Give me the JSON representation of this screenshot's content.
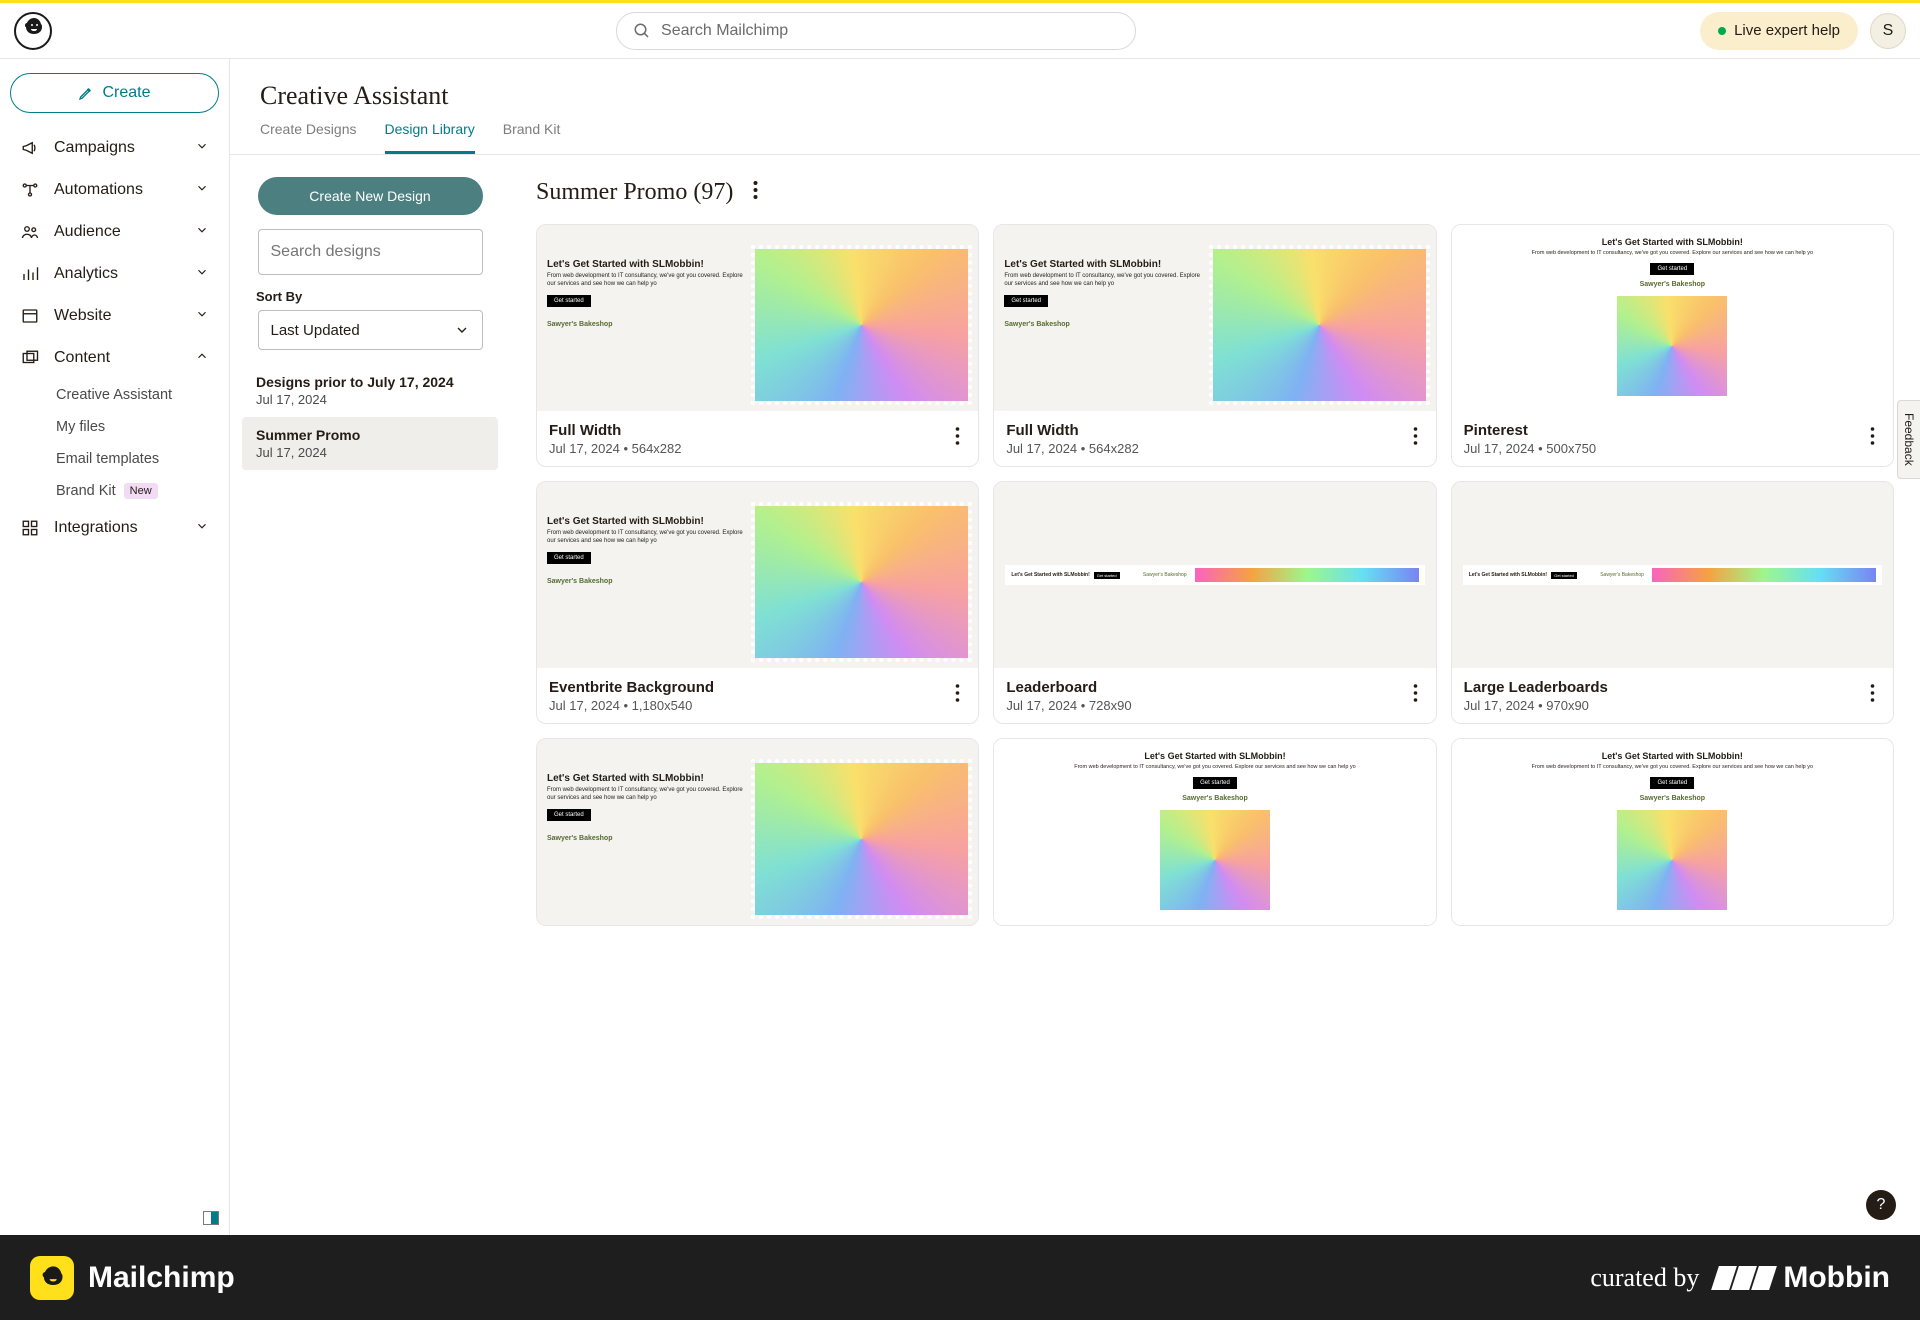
{
  "topbar": {
    "search_placeholder": "Search Mailchimp",
    "live_help": "Live expert help",
    "avatar_initial": "S"
  },
  "sidebar": {
    "create_label": "Create",
    "items": [
      {
        "label": "Campaigns",
        "expand": true
      },
      {
        "label": "Automations",
        "expand": true
      },
      {
        "label": "Audience",
        "expand": true
      },
      {
        "label": "Analytics",
        "expand": true
      },
      {
        "label": "Website",
        "expand": true
      },
      {
        "label": "Content",
        "expand": true,
        "open": true,
        "children": [
          {
            "label": "Creative Assistant"
          },
          {
            "label": "My files"
          },
          {
            "label": "Email templates"
          },
          {
            "label": "Brand Kit",
            "badge": "New"
          }
        ]
      },
      {
        "label": "Integrations",
        "expand": true
      }
    ]
  },
  "page": {
    "title": "Creative Assistant",
    "tabs": [
      {
        "label": "Create Designs"
      },
      {
        "label": "Design Library",
        "active": true
      },
      {
        "label": "Brand Kit"
      }
    ]
  },
  "leftPanel": {
    "create_new_design": "Create New Design",
    "search_placeholder": "Search designs",
    "sort_by_label": "Sort By",
    "sort_value": "Last Updated",
    "sessions": [
      {
        "title": "Designs prior to July 17, 2024",
        "date": "Jul 17, 2024"
      },
      {
        "title": "Summer Promo",
        "date": "Jul 17, 2024",
        "active": true
      }
    ]
  },
  "content": {
    "title": "Summer Promo (97)"
  },
  "cards": [
    {
      "title": "Full Width",
      "meta": "Jul 17, 2024 • 564x282",
      "type": "a"
    },
    {
      "title": "Full Width",
      "meta": "Jul 17, 2024 • 564x282",
      "type": "a"
    },
    {
      "title": "Pinterest",
      "meta": "Jul 17, 2024 • 500x750",
      "type": "pin"
    },
    {
      "title": "Eventbrite Background",
      "meta": "Jul 17, 2024 • 1,180x540",
      "type": "a"
    },
    {
      "title": "Leaderboard",
      "meta": "Jul 17, 2024 • 728x90",
      "type": "banner"
    },
    {
      "title": "Large Leaderboards",
      "meta": "Jul 17, 2024 • 970x90",
      "type": "banner"
    }
  ],
  "designCopy": {
    "heading": "Let's Get Started with SLMobbin!",
    "body": "From web development to IT consultancy, we've got you covered. Explore our services and see how we can help yo",
    "cta": "Get started",
    "brand": "Sawyer's Bakeshop",
    "banner_heading": "Let's Get Started with SLMobbin!"
  },
  "footer": {
    "brand": "Mailchimp",
    "curated": "curated by",
    "mobbin": "Mobbin"
  },
  "misc": {
    "feedback": "Feedback",
    "help": "?"
  }
}
